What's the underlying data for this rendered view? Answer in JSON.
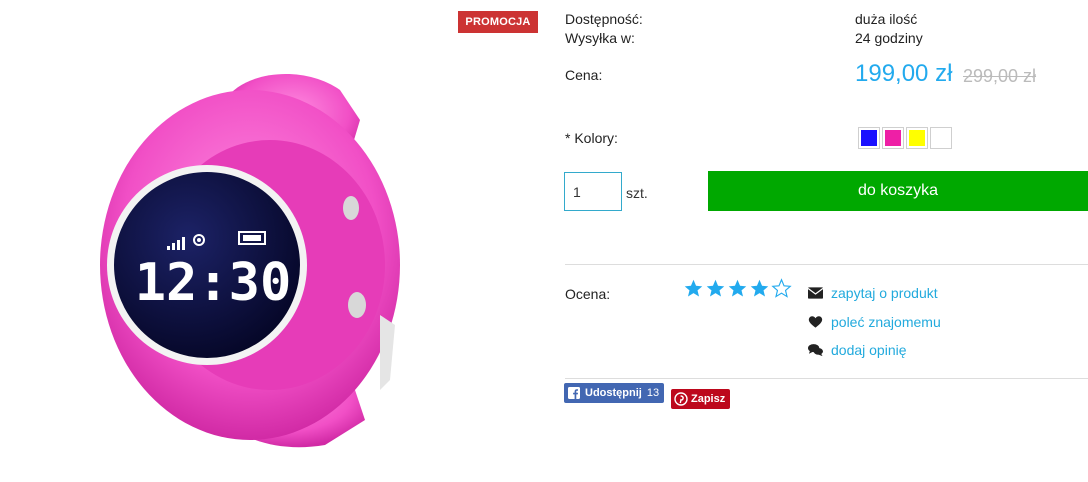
{
  "badge": {
    "promo_label": "PROMOCJA"
  },
  "product_image": {
    "alt": "pink smartwatch",
    "screen_time": "12:30"
  },
  "details": {
    "availability_label": "Dostępność:",
    "availability_value": "duża ilość",
    "shipping_label": "Wysyłka w:",
    "shipping_value": "24 godziny",
    "price_label": "Cena:",
    "price": "199,00 zł",
    "old_price": "299,00 zł",
    "colors_label": "* Kolory:"
  },
  "colors": [
    {
      "name": "blue",
      "hex": "#1a10ff"
    },
    {
      "name": "pink",
      "hex": "#ee1fa6"
    },
    {
      "name": "yellow",
      "hex": "#ffff00"
    },
    {
      "name": "white",
      "hex": "#ffffff"
    }
  ],
  "purchase": {
    "quantity_value": "1",
    "unit_label": "szt.",
    "cart_button_label": "do koszyka"
  },
  "rating": {
    "label": "Ocena:",
    "filled_stars": 4,
    "total_stars": 5
  },
  "actions": {
    "ask_label": "zapytaj o produkt",
    "recommend_label": "poleć znajomemu",
    "review_label": "dodaj opinię"
  },
  "share": {
    "facebook_label": "Udostępnij",
    "facebook_count": "13",
    "pinterest_label": "Zapisz"
  },
  "theme": {
    "accent": "#22aaee",
    "cart_green": "#00a800",
    "promo_red": "#cc3333"
  }
}
